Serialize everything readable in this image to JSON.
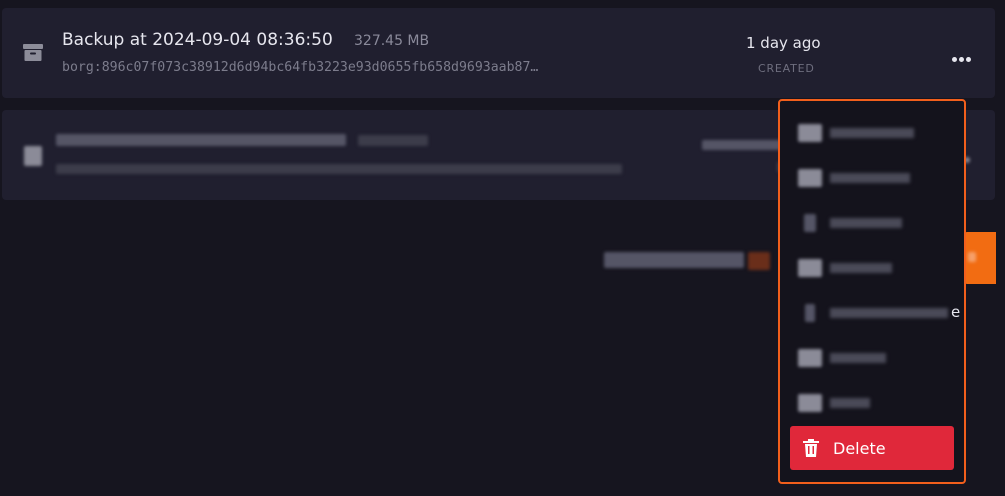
{
  "backups": [
    {
      "title": "Backup at 2024-09-04 08:36:50",
      "size": "327.45 MB",
      "hash": "borg:896c07f073c38912d6d94bc64fb3223e93d0655fb658d9693aab87…",
      "age": "1 day ago",
      "age_label": "CREATED",
      "icon": "archive-icon"
    }
  ],
  "menu": {
    "partial_letter": "e",
    "delete_label": "Delete",
    "delete_icon": "trash-icon"
  },
  "colors": {
    "accent": "#f25f1c",
    "danger": "#e0283a",
    "background": "#16151f",
    "card": "#201f2f"
  }
}
